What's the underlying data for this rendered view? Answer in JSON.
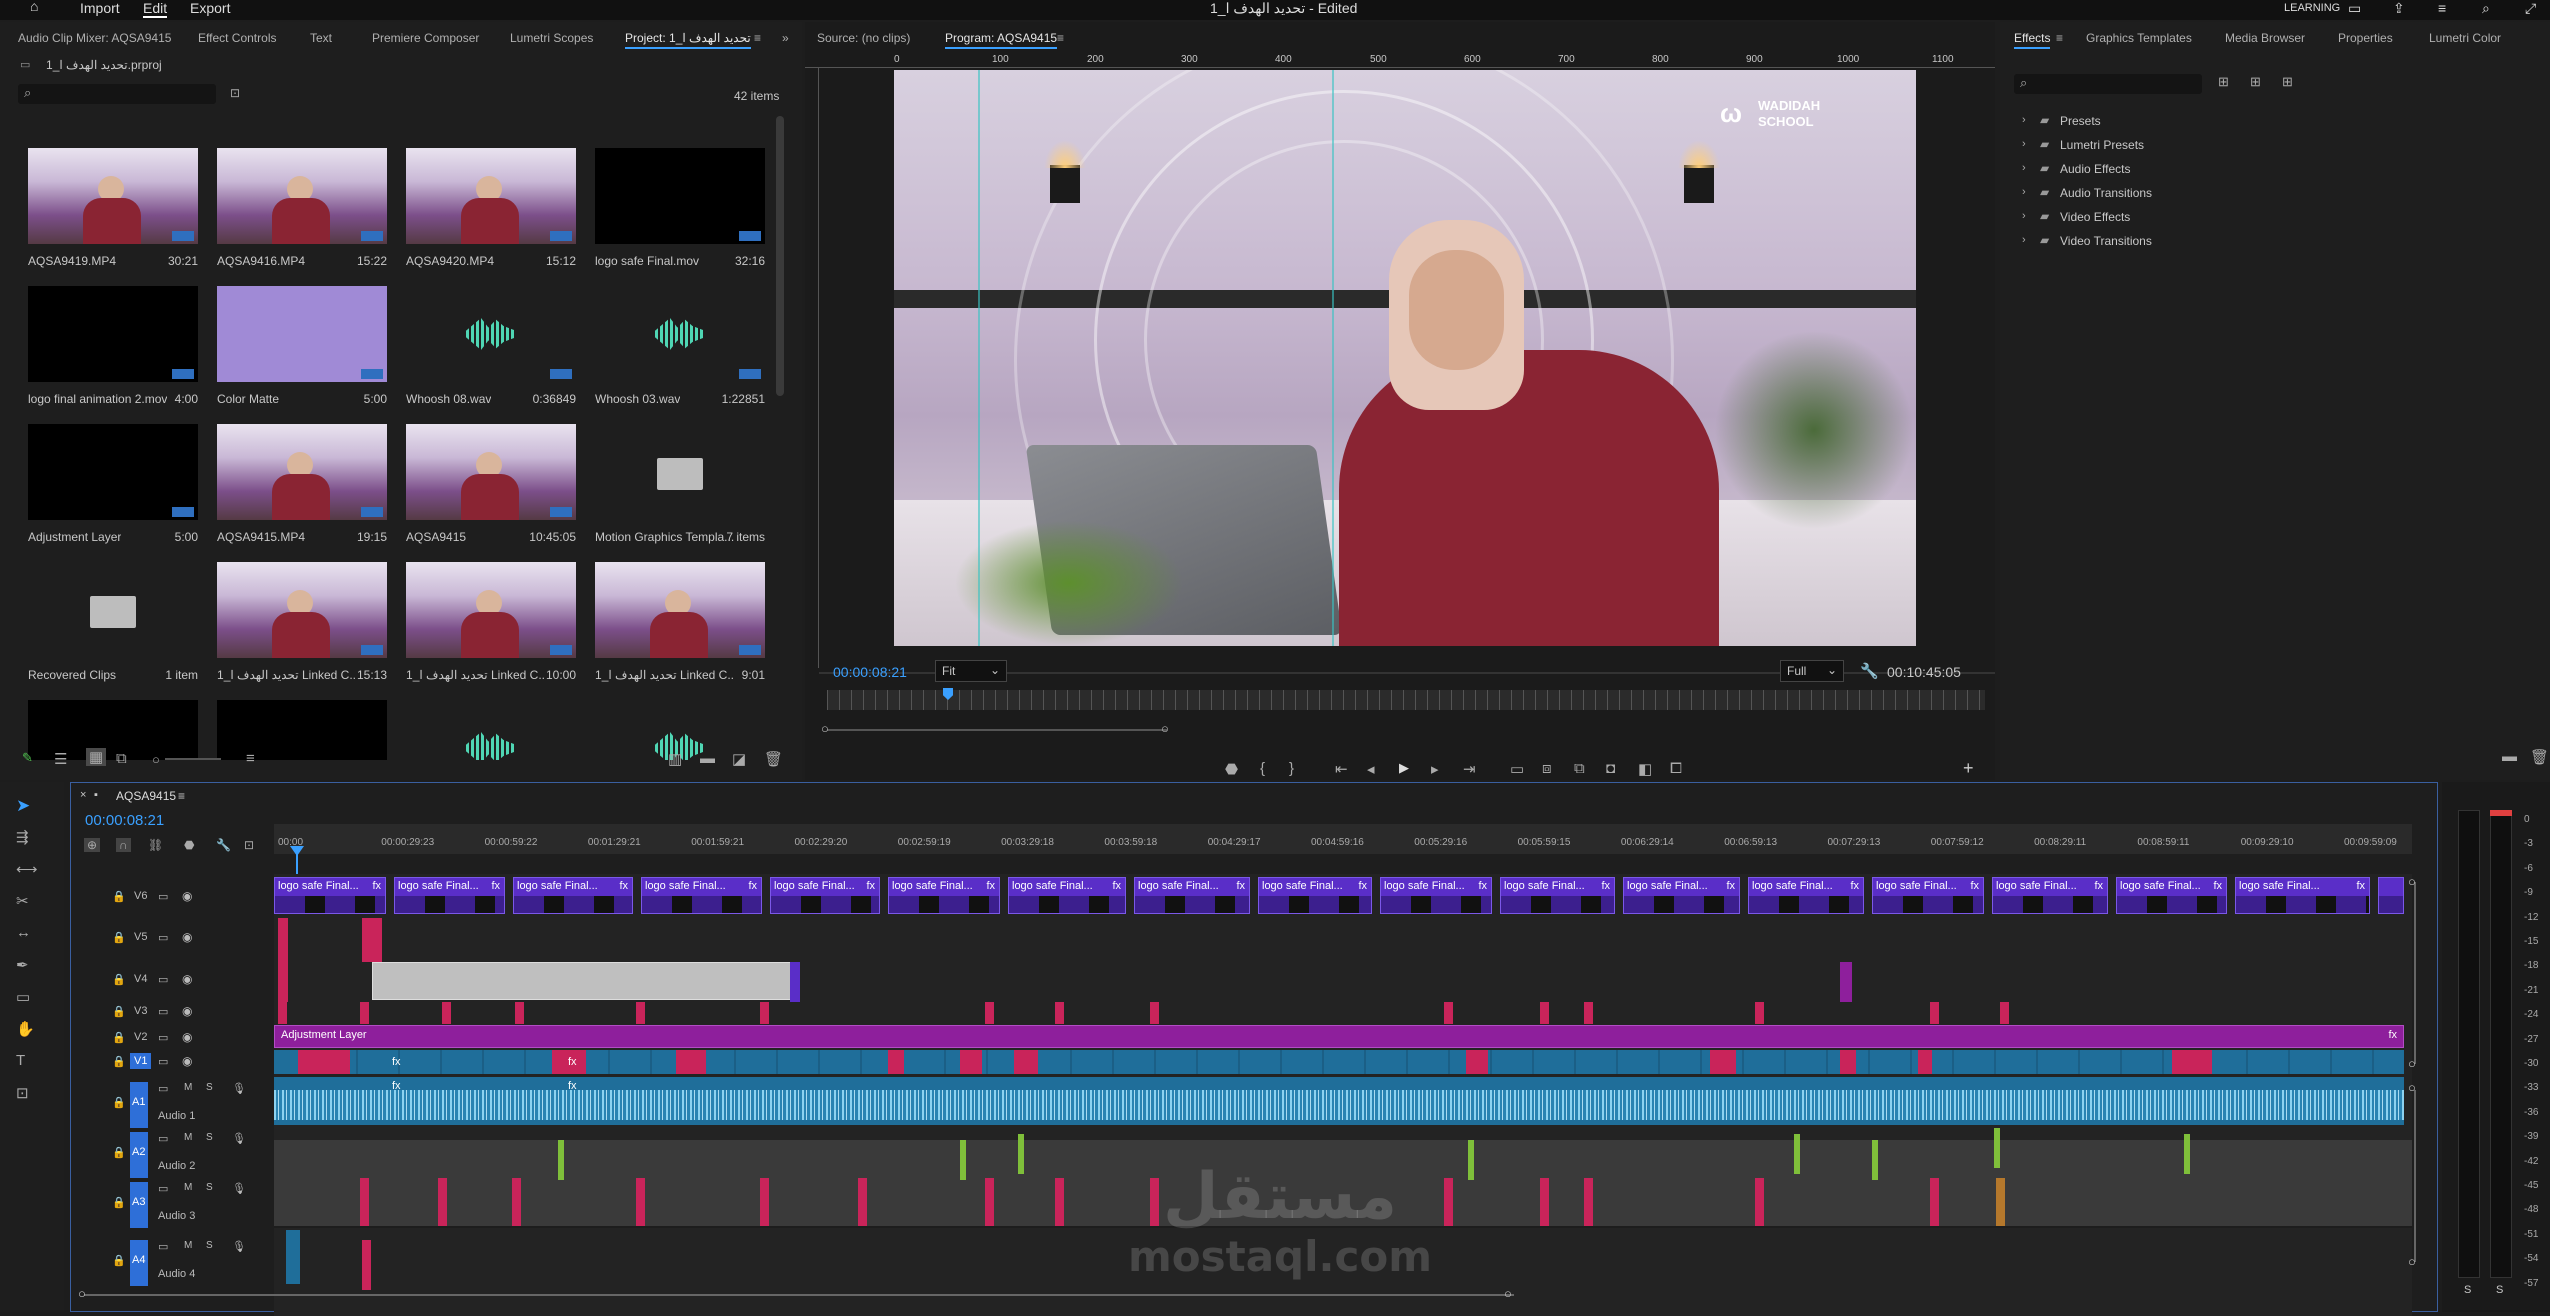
{
  "app": {
    "title": "تحديد الهدف ا_1 - Edited",
    "menu": [
      "Import",
      "Edit",
      "Export"
    ],
    "workspace": "LEARNING"
  },
  "project_panel": {
    "tabs": [
      "Audio Clip Mixer: AQSA9415",
      "Effect Controls",
      "Text",
      "Premiere Composer",
      "Lumetri Scopes",
      "Project: تحديد الهدف ا_1"
    ],
    "project_file": "تحديد الهدف ا_1.prproj",
    "item_count": "42 items",
    "items": [
      {
        "name": "AQSA9419.MP4",
        "dur": "30:21",
        "kind": "photo"
      },
      {
        "name": "AQSA9416.MP4",
        "dur": "15:22",
        "kind": "photo"
      },
      {
        "name": "AQSA9420.MP4",
        "dur": "15:12",
        "kind": "photo"
      },
      {
        "name": "logo safe Final.mov",
        "dur": "32:16",
        "kind": "black"
      },
      {
        "name": "logo final animation 2.mov",
        "dur": "4:00",
        "kind": "black"
      },
      {
        "name": "Color Matte",
        "dur": "5:00",
        "kind": "purple"
      },
      {
        "name": "Whoosh 08.wav",
        "dur": "0:36849",
        "kind": "audio"
      },
      {
        "name": "Whoosh 03.wav",
        "dur": "1:22851",
        "kind": "audio"
      },
      {
        "name": "Adjustment Layer",
        "dur": "5:00",
        "kind": "black"
      },
      {
        "name": "AQSA9415.MP4",
        "dur": "19:15",
        "kind": "photo"
      },
      {
        "name": "AQSA9415",
        "dur": "10:45:05",
        "kind": "photo"
      },
      {
        "name": "Motion Graphics Templa...",
        "dur": "7 items",
        "kind": "folder"
      },
      {
        "name": "Recovered Clips",
        "dur": "1 item",
        "kind": "folder"
      },
      {
        "name": "تحديد الهدف ا_1 Linked C...",
        "dur": "15:13",
        "kind": "photo"
      },
      {
        "name": "تحديد الهدف ا_1 Linked C...",
        "dur": "10:00",
        "kind": "photo"
      },
      {
        "name": "تحديد الهدف ا_1 Linked C...",
        "dur": "9:01",
        "kind": "photo"
      },
      {
        "name": "",
        "dur": "",
        "kind": "black"
      },
      {
        "name": "",
        "dur": "",
        "kind": "black"
      },
      {
        "name": "",
        "dur": "",
        "kind": "audio"
      },
      {
        "name": "",
        "dur": "",
        "kind": "audio"
      }
    ]
  },
  "monitor": {
    "source_tab": "Source: (no clips)",
    "program_tab": "Program: AQSA9415",
    "ruler": [
      "0",
      "100",
      "200",
      "300",
      "400",
      "500",
      "600",
      "700",
      "800",
      "900",
      "1000",
      "1100"
    ],
    "timecode": "00:00:08:21",
    "fit": "Fit",
    "quality": "Full",
    "duration": "00:10:45:05",
    "logo_line1": "WADIDAH",
    "logo_line2": "SCHOOL"
  },
  "effects_panel": {
    "tabs": [
      "Effects",
      "Graphics Templates",
      "Media Browser",
      "Properties",
      "Lumetri Color"
    ],
    "tree": [
      "Presets",
      "Lumetri Presets",
      "Audio Effects",
      "Audio Transitions",
      "Video Effects",
      "Video Transitions"
    ]
  },
  "timeline": {
    "sequence": "AQSA9415",
    "timecode": "00:00:08:21",
    "ruler": [
      "00:00",
      "00:00:29:23",
      "00:00:59:22",
      "00:01:29:21",
      "00:01:59:21",
      "00:02:29:20",
      "00:02:59:19",
      "00:03:29:18",
      "00:03:59:18",
      "00:04:29:17",
      "00:04:59:16",
      "00:05:29:16",
      "00:05:59:15",
      "00:06:29:14",
      "00:06:59:13",
      "00:07:29:13",
      "00:07:59:12",
      "00:08:29:11",
      "00:08:59:11",
      "00:09:29:10",
      "00:09:59:09"
    ],
    "video_tracks": [
      "V6",
      "V5",
      "V4",
      "V3",
      "V2",
      "V1"
    ],
    "audio_tracks": [
      {
        "id": "A1",
        "name": "Audio 1"
      },
      {
        "id": "A2",
        "name": "Audio 2"
      },
      {
        "id": "A3",
        "name": "Audio 3"
      },
      {
        "id": "A4",
        "name": "Audio 4"
      }
    ],
    "clip_label": "logo safe Final...",
    "adjustment_label": "Adjustment Layer",
    "fx": "fx"
  },
  "meter": {
    "scale": [
      "0",
      "-3",
      "-6",
      "-9",
      "-12",
      "-15",
      "-18",
      "-21",
      "-24",
      "-27",
      "-30",
      "-33",
      "-36",
      "-39",
      "-42",
      "-45",
      "-48",
      "-51",
      "-54",
      "-57"
    ],
    "solo": [
      "S",
      "S"
    ]
  },
  "watermark": {
    "ar": "مستقل",
    "en": "mostaql.com"
  },
  "colors": {
    "accent": "#3aa0ff",
    "clip_purple": "#5a2ec8",
    "adjustment": "#8e1f9c",
    "audio": "#1f6e9a",
    "marker": "#c9245a"
  }
}
